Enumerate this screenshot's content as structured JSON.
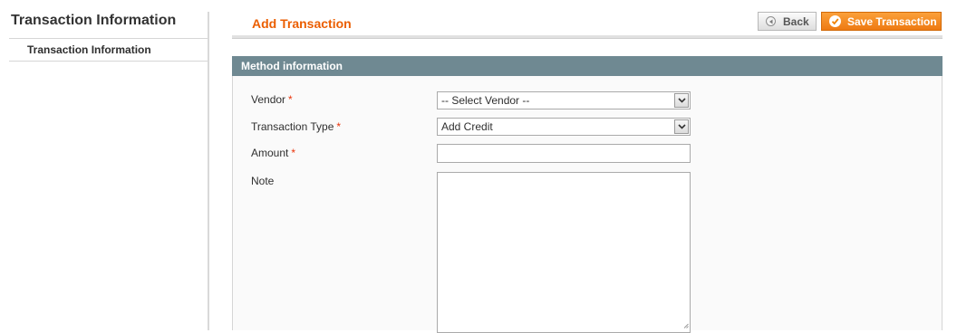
{
  "sidebar": {
    "title": "Transaction Information",
    "tabs": [
      {
        "label": "Transaction Information",
        "active": true
      }
    ]
  },
  "header": {
    "title": "Add Transaction",
    "back_label": "Back",
    "save_label": "Save Transaction",
    "back_icon": "chevron-left-icon",
    "save_icon": "check-circle-icon"
  },
  "fieldset": {
    "title": "Method information",
    "fields": {
      "vendor": {
        "label": "Vendor",
        "required_mark": "*",
        "value": "-- Select Vendor --"
      },
      "transaction_type": {
        "label": "Transaction Type",
        "required_mark": "*",
        "value": "Add Credit"
      },
      "amount": {
        "label": "Amount",
        "required_mark": "*",
        "value": ""
      },
      "note": {
        "label": "Note",
        "value": ""
      }
    }
  },
  "colors": {
    "accent": "#eb5e00",
    "save_button": "#f18200",
    "fieldset_header": "#6f8992",
    "required": "#eb340a"
  }
}
